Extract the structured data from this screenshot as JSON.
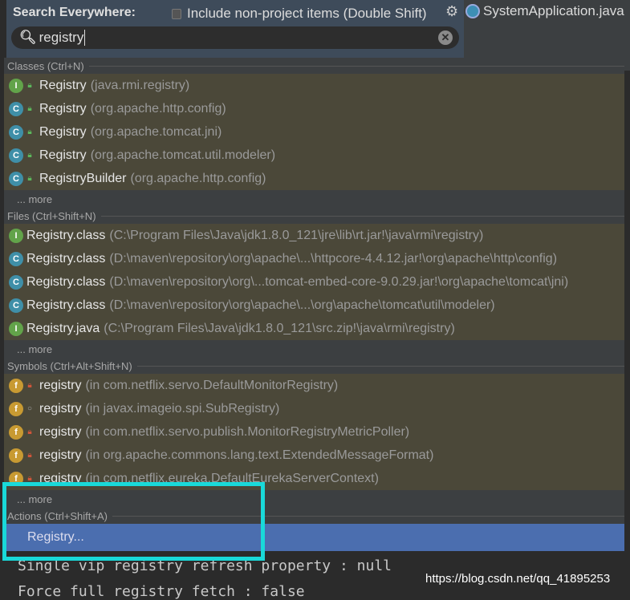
{
  "header": {
    "title": "Search Everywhere:",
    "include_label": "Include non-project items (Double Shift)",
    "include_checked": false,
    "query": "registry"
  },
  "editor_tab": "SystemApplication.java",
  "console": [
    "Single vip registry refresh property : null",
    "Force full registry fetch : false"
  ],
  "watermark": "https://blog.csdn.net/qq_41895253",
  "sections": [
    {
      "title": "Classes (Ctrl+N)",
      "more": "... more",
      "items": [
        {
          "icon": "I",
          "vis": "open",
          "name": "Registry",
          "ctx": "(java.rmi.registry)"
        },
        {
          "icon": "C",
          "vis": "open",
          "name": "Registry",
          "ctx": "(org.apache.http.config)"
        },
        {
          "icon": "C",
          "vis": "open",
          "name": "Registry",
          "ctx": "(org.apache.tomcat.jni)"
        },
        {
          "icon": "C",
          "vis": "open",
          "name": "Registry",
          "ctx": "(org.apache.tomcat.util.modeler)"
        },
        {
          "icon": "C",
          "vis": "open",
          "name": "RegistryBuilder",
          "ctx": "(org.apache.http.config)"
        }
      ]
    },
    {
      "title": "Files (Ctrl+Shift+N)",
      "more": "... more",
      "items": [
        {
          "icon": "I",
          "name": "Registry.class",
          "ctx": "(C:\\Program Files\\Java\\jdk1.8.0_121\\jre\\lib\\rt.jar!\\java\\rmi\\registry)"
        },
        {
          "icon": "C",
          "name": "Registry.class",
          "ctx": "(D:\\maven\\repository\\org\\apache\\...\\httpcore-4.4.12.jar!\\org\\apache\\http\\config)"
        },
        {
          "icon": "C",
          "name": "Registry.class",
          "ctx": "(D:\\maven\\repository\\org\\...tomcat-embed-core-9.0.29.jar!\\org\\apache\\tomcat\\jni)"
        },
        {
          "icon": "C",
          "name": "Registry.class",
          "ctx": "(D:\\maven\\repository\\org\\apache\\...\\org\\apache\\tomcat\\util\\modeler)"
        },
        {
          "icon": "I",
          "name": "Registry.java",
          "ctx": "(C:\\Program Files\\Java\\jdk1.8.0_121\\src.zip!\\java\\rmi\\registry)"
        }
      ]
    },
    {
      "title": "Symbols (Ctrl+Alt+Shift+N)",
      "more": "... more",
      "items": [
        {
          "icon": "f",
          "vis": "private",
          "name": "registry",
          "ctx": "(in com.netflix.servo.DefaultMonitorRegistry)"
        },
        {
          "icon": "f",
          "vis": "package",
          "name": "registry",
          "ctx": "(in javax.imageio.spi.SubRegistry)"
        },
        {
          "icon": "f",
          "vis": "private",
          "name": "registry",
          "ctx": "(in com.netflix.servo.publish.MonitorRegistryMetricPoller)"
        },
        {
          "icon": "f",
          "vis": "private",
          "name": "registry",
          "ctx": "(in org.apache.commons.lang.text.ExtendedMessageFormat)"
        },
        {
          "icon": "f",
          "vis": "private",
          "name": "registry",
          "ctx": "(in com.netflix.eureka.DefaultEurekaServerContext)"
        }
      ]
    }
  ],
  "actions": {
    "title": "Actions (Ctrl+Shift+A)",
    "items": [
      "Registry..."
    ]
  },
  "colors": {
    "selected": "#4b6eaf",
    "highlight_box": "#19d9d9",
    "match_row": "#4b4839"
  }
}
